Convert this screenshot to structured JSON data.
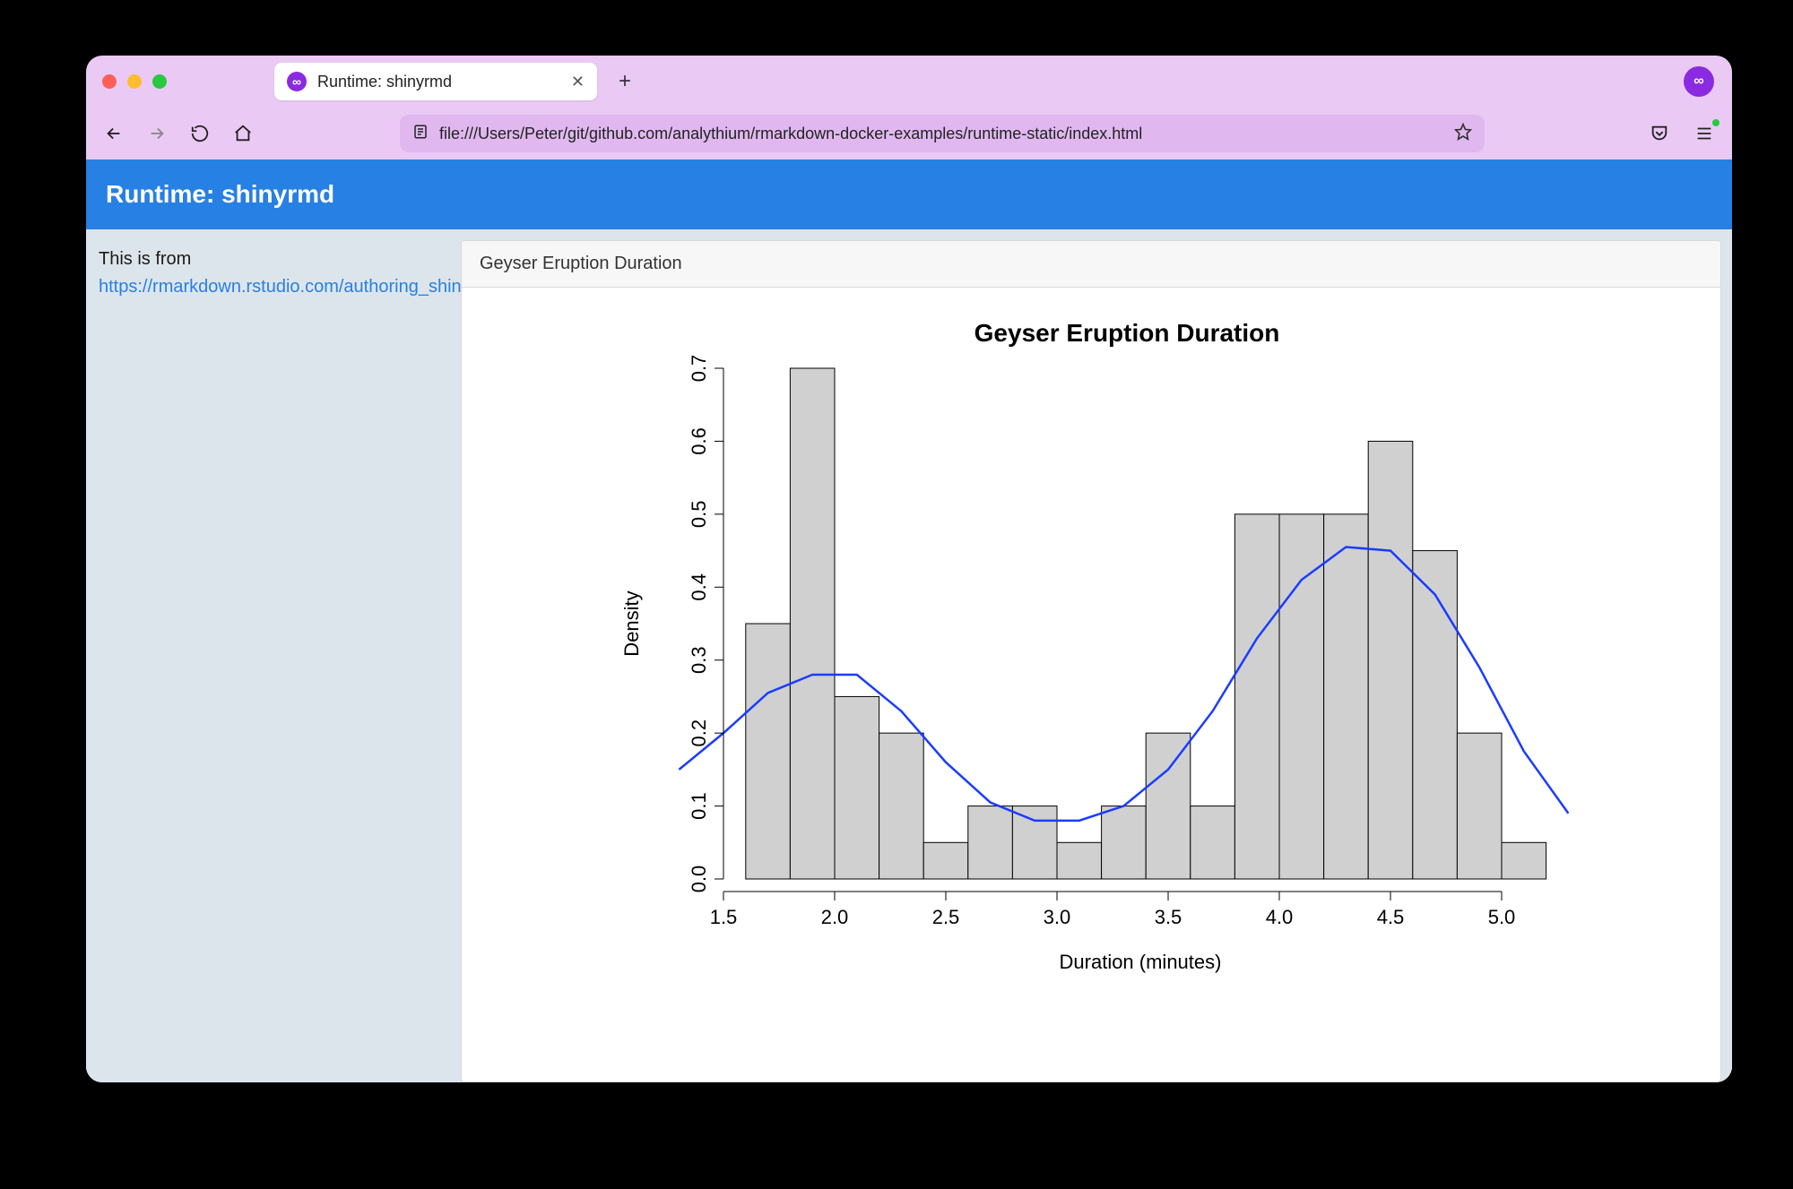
{
  "browser": {
    "tab_title": "Runtime: shinyrmd",
    "url": "file:///Users/Peter/git/github.com/analythium/rmarkdown-docker-examples/runtime-static/index.html"
  },
  "app": {
    "header_title": "Runtime: shinyrmd",
    "sidebar_intro": "This is from ",
    "sidebar_link_text": "https://rmarkdown.rstudio.com/authoring_shiny_prerendered.HTML",
    "sidebar_trail": ".",
    "panel_title": "Geyser Eruption Duration"
  },
  "chart_data": {
    "type": "bar",
    "title": "Geyser Eruption Duration",
    "xlabel": "Duration (minutes)",
    "ylabel": "Density",
    "xlim": [
      1.5,
      5.25
    ],
    "ylim": [
      0.0,
      0.7
    ],
    "x_ticks": [
      1.5,
      2.0,
      2.5,
      3.0,
      3.5,
      4.0,
      4.5,
      5.0
    ],
    "y_ticks": [
      0.0,
      0.1,
      0.2,
      0.3,
      0.4,
      0.5,
      0.6,
      0.7
    ],
    "bin_width": 0.2,
    "bin_left_edges": [
      1.6,
      1.8,
      2.0,
      2.2,
      2.4,
      2.6,
      2.8,
      3.0,
      3.2,
      3.4,
      3.6,
      3.8,
      4.0,
      4.2,
      4.4,
      4.6,
      4.8,
      5.0
    ],
    "values": [
      0.35,
      0.7,
      0.25,
      0.2,
      0.05,
      0.1,
      0.1,
      0.05,
      0.1,
      0.2,
      0.1,
      0.5,
      0.5,
      0.5,
      0.6,
      0.45,
      0.2,
      0.05
    ],
    "density_curve": {
      "x": [
        1.3,
        1.5,
        1.7,
        1.9,
        2.1,
        2.3,
        2.5,
        2.7,
        2.9,
        3.1,
        3.3,
        3.5,
        3.7,
        3.9,
        4.1,
        4.3,
        4.5,
        4.7,
        4.9,
        5.1,
        5.3
      ],
      "y": [
        0.15,
        0.2,
        0.255,
        0.28,
        0.28,
        0.23,
        0.16,
        0.105,
        0.08,
        0.08,
        0.1,
        0.15,
        0.23,
        0.33,
        0.41,
        0.455,
        0.45,
        0.39,
        0.29,
        0.175,
        0.09
      ],
      "color": "#1a3cff"
    }
  }
}
